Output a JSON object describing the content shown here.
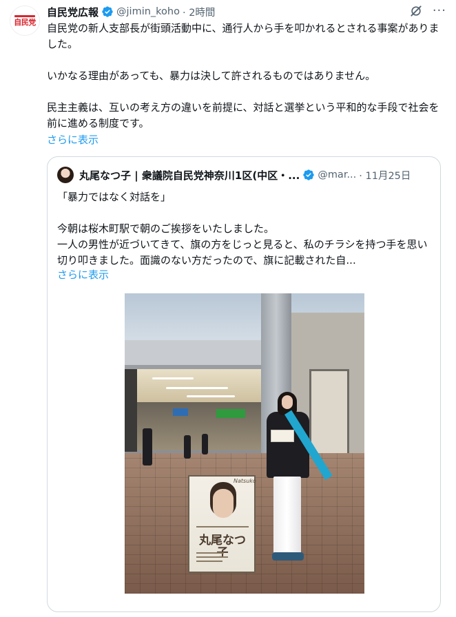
{
  "tweet": {
    "author": {
      "name": "自民党広報",
      "handle": "@jimin_koho",
      "time": "· 2時間",
      "avatar_logo_text": "自民党",
      "verified": true
    },
    "body": [
      "自民党の新人支部長が街頭活動中に、通行人から手を叩かれるとされる事案がありました。",
      "いかなる理由があっても、暴力は決して許されるものではありません。",
      "民主主義は、互いの考え方の違いを前提に、対話と選挙という平和的な手段で社会を前に進める制度です。"
    ],
    "show_more": "さらに表示",
    "actions": {
      "grok_icon": "grok-icon",
      "more_label": "···"
    }
  },
  "quote": {
    "author": {
      "name": "丸尾なつ子 | 衆議院自民党神奈川1区(中区・...",
      "handle": "@mar...",
      "time": "· 11月25日",
      "verified": true
    },
    "body": [
      "「暴力ではなく対話を」",
      "今朝は桜木町駅で朝のご挨拶をいたしました。",
      "一人の男性が近づいてきて、旗の方をじっと見ると、私のチラシを持つ手を思い切り叩きました。面識のない方だったので、旗に記載された自..."
    ],
    "show_more": "さらに表示",
    "photo": {
      "board_name": "丸尾なつ子",
      "board_top_text": "Natsuko"
    }
  },
  "colors": {
    "link": "#1d9bf0",
    "verified": "#1d9bf0",
    "secondary_text": "#536471",
    "border": "#cfd9de",
    "brand_red": "#d8262e"
  }
}
